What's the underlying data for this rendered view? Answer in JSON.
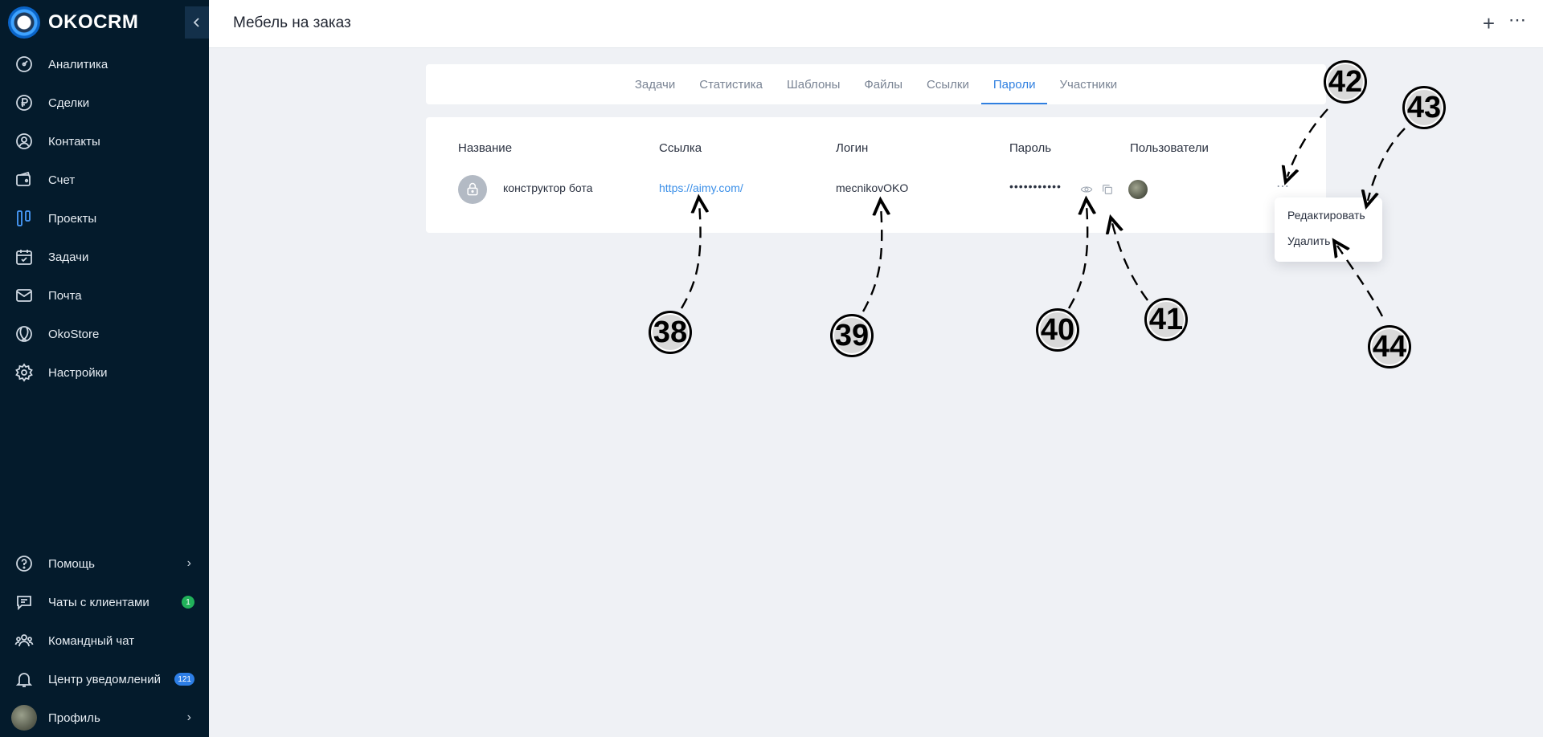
{
  "app": {
    "logo_text": "OKOCRM"
  },
  "sidebar": {
    "items": [
      {
        "label": "Аналитика",
        "icon": "analytics-icon"
      },
      {
        "label": "Сделки",
        "icon": "ruble-icon"
      },
      {
        "label": "Контакты",
        "icon": "contacts-icon"
      },
      {
        "label": "Счет",
        "icon": "invoice-icon"
      },
      {
        "label": "Проекты",
        "icon": "projects-icon",
        "active": true
      },
      {
        "label": "Задачи",
        "icon": "calendar-icon"
      },
      {
        "label": "Почта",
        "icon": "mail-icon"
      },
      {
        "label": "OkoStore",
        "icon": "store-icon"
      },
      {
        "label": "Настройки",
        "icon": "gear-icon"
      }
    ],
    "bottom": {
      "help": "Помощь",
      "client_chats": "Чаты с клиентами",
      "client_chats_badge": "1",
      "team_chat": "Командный чат",
      "notifications": "Центр уведомлений",
      "notifications_badge": "121",
      "profile": "Профиль"
    }
  },
  "header": {
    "title": "Мебель на заказ"
  },
  "tabs": [
    {
      "label": "Задачи"
    },
    {
      "label": "Статистика"
    },
    {
      "label": "Шаблоны"
    },
    {
      "label": "Файлы"
    },
    {
      "label": "Ссылки"
    },
    {
      "label": "Пароли",
      "active": true
    },
    {
      "label": "Участники"
    }
  ],
  "passwords": {
    "columns": [
      "Название",
      "Ссылка",
      "Логин",
      "Пароль",
      "Пользователи"
    ],
    "rows": [
      {
        "name": "конструктор бота",
        "link": "https://aimy.com/",
        "login": "mecnikovOKO",
        "password": "•••••••••••"
      }
    ]
  },
  "row_menu": {
    "edit": "Редактировать",
    "delete": "Удалить"
  },
  "callouts": [
    "38",
    "39",
    "40",
    "41",
    "42",
    "43",
    "44"
  ],
  "colors": {
    "sidebar_bg": "#041b2c",
    "accent": "#2f7fe0",
    "link": "#3b8fe8",
    "badge_green": "#21b15a",
    "badge_blue": "#2d7ee6"
  }
}
